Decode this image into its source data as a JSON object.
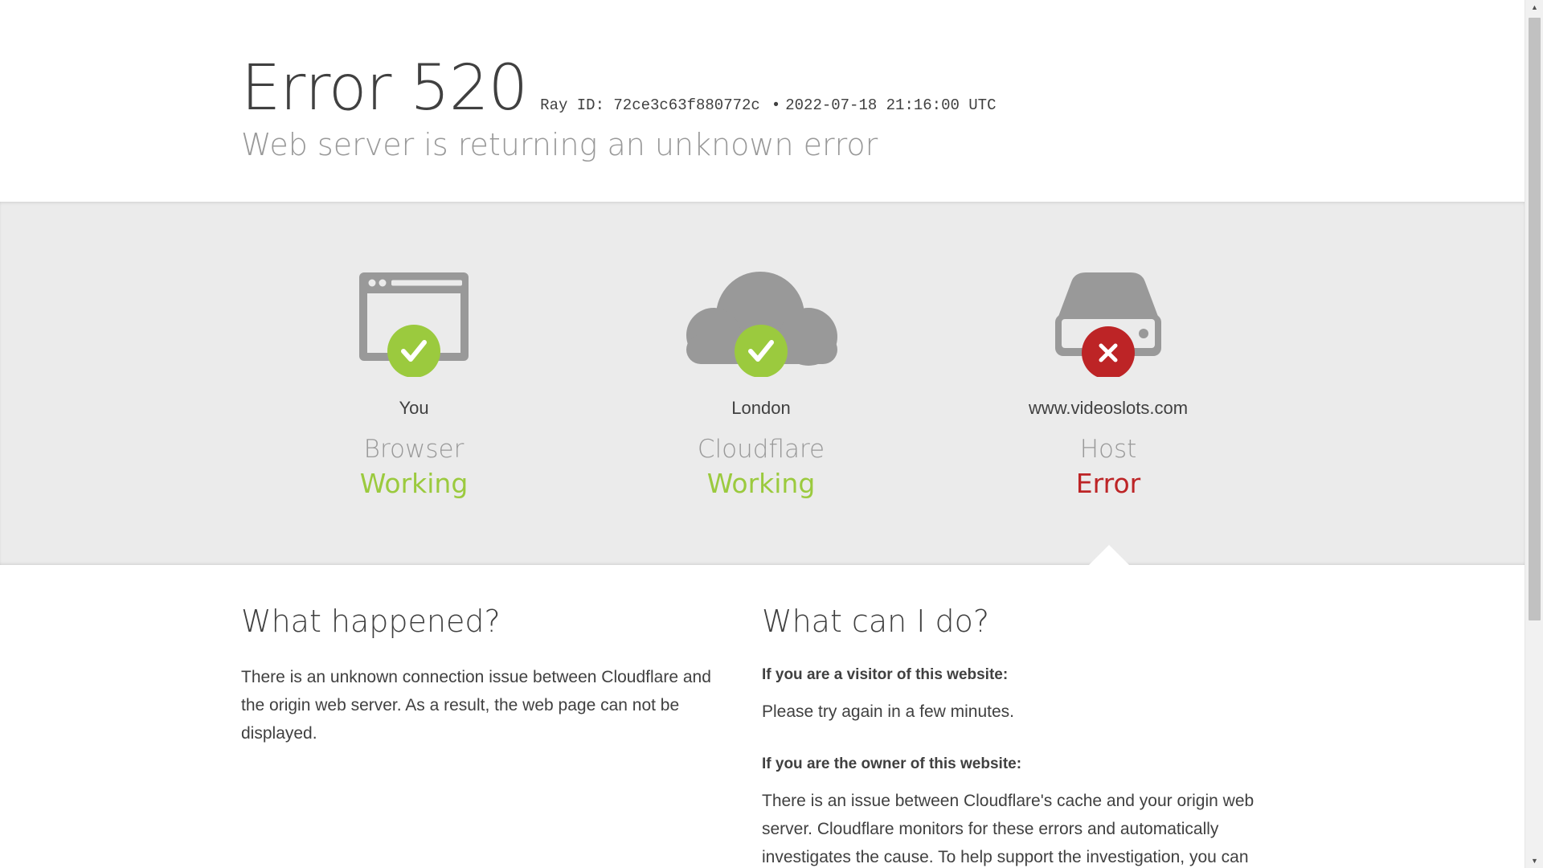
{
  "header": {
    "error_title": "Error 520",
    "ray_label": "Ray ID: 72ce3c63f880772c",
    "separator": "•",
    "timestamp": "2022-07-18 21:16:00 UTC",
    "subtitle": "Web server is returning an unknown error"
  },
  "status": {
    "browser": {
      "location": "You",
      "kind": "Browser",
      "state": "Working",
      "icon": "browser-icon",
      "badge": "check"
    },
    "cloudflare": {
      "location": "London",
      "kind": "Cloudflare",
      "state": "Working",
      "icon": "cloud-icon",
      "badge": "check"
    },
    "host": {
      "location": "www.videoslots.com",
      "kind": "Host",
      "state": "Error",
      "icon": "server-icon",
      "badge": "cross"
    }
  },
  "colors": {
    "ok": "#9bca3e",
    "error": "#bd2426",
    "icon_gray": "#999999",
    "band": "#ebebeb"
  },
  "info": {
    "what_happened_title": "What happened?",
    "what_happened_text": "There is an unknown connection issue between Cloudflare and the origin web server. As a result, the web page can not be displayed.",
    "what_can_i_do_title": "What can I do?",
    "visitor_label": "If you are a visitor of this website:",
    "visitor_text": "Please try again in a few minutes.",
    "owner_label": "If you are the owner of this website:",
    "owner_text": "There is an issue between Cloudflare's cache and your origin web server. Cloudflare monitors for these errors and automatically investigates the cause. To help support the investigation, you can"
  }
}
